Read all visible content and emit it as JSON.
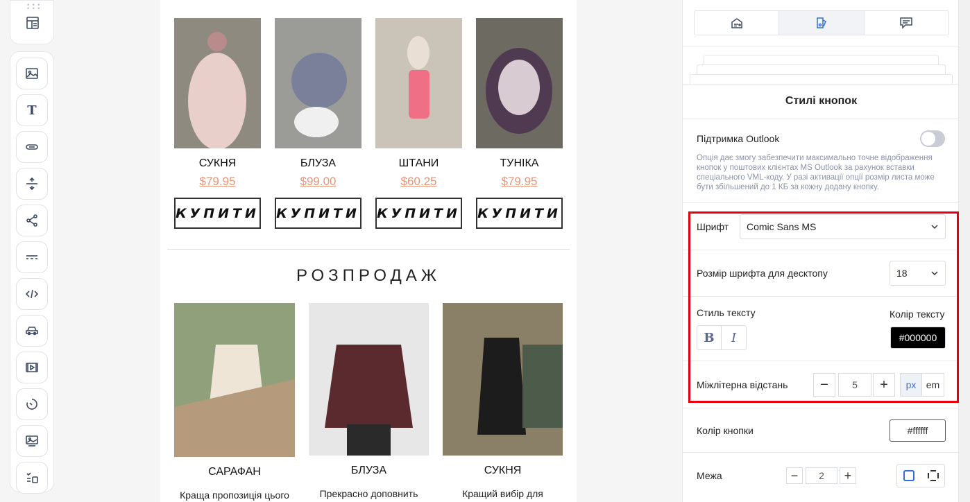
{
  "toolbar": {
    "top_icon": "layout-icon",
    "items": [
      "image-icon",
      "text-icon",
      "button-icon",
      "spacer-icon",
      "social-icon",
      "divider-icon",
      "html-icon",
      "menu-icon",
      "video-icon",
      "timer-icon",
      "banner-icon",
      "amp-icon"
    ]
  },
  "canvas": {
    "products_row1": [
      {
        "name": "СУКНЯ",
        "price": "$79.95",
        "button": "КУПИТИ",
        "img_colors": [
          "#8f8a80",
          "#e8cfc9",
          "#b88c8a"
        ]
      },
      {
        "name": "БЛУЗА",
        "price": "$99.00",
        "button": "КУПИТИ",
        "img_colors": [
          "#9b9b98",
          "#7a7f9a",
          "#f0f0f0"
        ]
      },
      {
        "name": "ШТАНИ",
        "price": "$60.25",
        "button": "КУПИТИ",
        "img_colors": [
          "#c9c3b8",
          "#ef6f86",
          "#e9dfd4"
        ]
      },
      {
        "name": "ТУНІКА",
        "price": "$79.95",
        "button": "КУПИТИ",
        "img_colors": [
          "#6d6a62",
          "#4f3a52",
          "#d8ccd2"
        ]
      }
    ],
    "section_title": "РОЗПРОДАЖ",
    "products_row2": [
      {
        "name": "САРАФАН",
        "desc": "Краща пропозиція цього",
        "img_colors": [
          "#8fa07a",
          "#efe5d6",
          "#b59b7c"
        ]
      },
      {
        "name": "БЛУЗА",
        "desc": "Прекрасно доповнить",
        "img_colors": [
          "#e7e7e7",
          "#5a2a2e",
          "#2a2a2a"
        ]
      },
      {
        "name": "СУКНЯ",
        "desc": "Кращий вибір для",
        "img_colors": [
          "#8a8068",
          "#1c1c1c",
          "#4d5b4a"
        ]
      }
    ]
  },
  "panel": {
    "tabs": [
      "blocks-icon",
      "styles-icon",
      "comment-icon"
    ],
    "title": "Стилі кнопок",
    "outlook_label": "Підтримка Outlook",
    "outlook_on": false,
    "outlook_help": "Опція дає змогу забезпечити максимально точне відображення кнопок у поштових клієнтах MS Outlook за рахунок вставки спеціального VML-коду. У разі активації опції розмір листа може бути збільшений до 1 КБ за кожну додану кнопку.",
    "font_label": "Шрифт",
    "font_value": "Comic Sans MS",
    "font_size_label": "Розмір шрифта для десктопу",
    "font_size_value": "18",
    "text_style_label": "Стиль тексту",
    "bold_label": "B",
    "italic_label": "I",
    "text_color_label": "Колір тексту",
    "text_color_value": "#000000",
    "letter_spacing_label": "Міжлітерна відстань",
    "letter_spacing_value": "5",
    "unit_px": "px",
    "unit_em": "em",
    "button_color_label": "Колір кнопки",
    "button_color_value": "#ffffff",
    "border_label": "Межа",
    "border_value": "2",
    "minus": "−",
    "plus": "+"
  }
}
